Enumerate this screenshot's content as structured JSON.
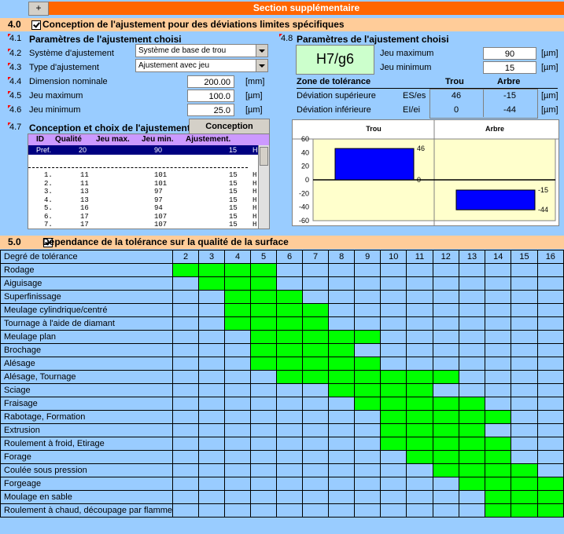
{
  "topbar": {
    "plus": "+",
    "title": "Section supplémentaire"
  },
  "s40": {
    "num": "4.0",
    "title": "Conception de l'ajustement pour des déviations limites spécifiques"
  },
  "s41": {
    "num": "4.1",
    "title": "Paramètres de l'ajustement choisi"
  },
  "r42": {
    "num": "4.2",
    "label": "Système d'ajustement",
    "value": "Système de base de trou"
  },
  "r43": {
    "num": "4.3",
    "label": "Type d'ajustement",
    "value": "Ajustement avec jeu"
  },
  "r44": {
    "num": "4.4",
    "label": "Dimension nominale",
    "value": "200.00",
    "unit": "[mm]"
  },
  "r45": {
    "num": "4.5",
    "label": "Jeu maximum",
    "value": "100.0",
    "unit": "[µm]"
  },
  "r46": {
    "num": "4.6",
    "label": "Jeu minimum",
    "value": "25.0",
    "unit": "[µm]"
  },
  "s47": {
    "num": "4.7",
    "title": "Conception et choix de l'ajustement",
    "button": "Conception"
  },
  "list": {
    "headers": [
      "ID",
      "Qualité",
      "Jeu max.",
      "Jeu min.",
      "Ajustement."
    ],
    "pref": {
      "id": "Pref.",
      "q": "20",
      "max": "90",
      "min": "15",
      "adj": "H"
    },
    "rows": [
      {
        "id": "1.",
        "q": "11",
        "max": "101",
        "min": "15",
        "adj": "H"
      },
      {
        "id": "2.",
        "q": "11",
        "max": "101",
        "min": "15",
        "adj": "H"
      },
      {
        "id": "3.",
        "q": "13",
        "max": "97",
        "min": "15",
        "adj": "H"
      },
      {
        "id": "4.",
        "q": "13",
        "max": "97",
        "min": "15",
        "adj": "H"
      },
      {
        "id": "5.",
        "q": "16",
        "max": "94",
        "min": "15",
        "adj": "H"
      },
      {
        "id": "6.",
        "q": "17",
        "max": "107",
        "min": "15",
        "adj": "H"
      },
      {
        "id": "7.",
        "q": "17",
        "max": "107",
        "min": "15",
        "adj": "H"
      }
    ]
  },
  "s48": {
    "num": "4.8",
    "title": "Paramètres de l'ajustement choisi",
    "fit": "H7/g6",
    "jmax_label": "Jeu maximum",
    "jmax": "90",
    "jmin_label": "Jeu minimum",
    "jmin": "15",
    "unit": "[µm]"
  },
  "tol": {
    "title": "Zone de tolérance",
    "col_trou": "Trou",
    "col_arbre": "Arbre",
    "sup_label": "Déviation supérieure",
    "sup_sym": "ES/es",
    "sup_trou": "46",
    "sup_arbre": "-15",
    "inf_label": "Déviation inférieure",
    "inf_sym": "EI/ei",
    "inf_trou": "0",
    "inf_arbre": "-44",
    "unit": "[µm]"
  },
  "chart_data": {
    "type": "bar",
    "categories": [
      "Trou",
      "Arbre"
    ],
    "series": [
      {
        "upper": 46,
        "lower": 0
      },
      {
        "upper": -15,
        "lower": -44
      }
    ],
    "bar_labels": [
      [
        "46",
        "0"
      ],
      [
        "-15",
        "-44"
      ]
    ],
    "ylim": [
      -60,
      60
    ],
    "yticks": [
      60,
      40,
      20,
      0,
      -20,
      -40,
      -60
    ],
    "bar_color": "#0000ff",
    "bg_color": "#ffffcc"
  },
  "s50": {
    "num": "5.0",
    "title": "Dépendance de la tolérance sur la qualité de la surface"
  },
  "surface": {
    "header": "Degré de tolérance",
    "grades": [
      "2",
      "3",
      "4",
      "5",
      "6",
      "7",
      "8",
      "9",
      "10",
      "11",
      "12",
      "13",
      "14",
      "15",
      "16"
    ],
    "rows": [
      {
        "name": "Rodage",
        "from": 2,
        "to": 5
      },
      {
        "name": "Aiguisage",
        "from": 3,
        "to": 5
      },
      {
        "name": "Superfinissage",
        "from": 4,
        "to": 6
      },
      {
        "name": "Meulage cylindrique/centré",
        "from": 4,
        "to": 7
      },
      {
        "name": "Tournage à l'aide de diamant",
        "from": 4,
        "to": 7
      },
      {
        "name": "Meulage plan",
        "from": 5,
        "to": 9
      },
      {
        "name": "Brochage",
        "from": 5,
        "to": 8
      },
      {
        "name": "Alésage",
        "from": 5,
        "to": 9
      },
      {
        "name": "Alésage, Tournage",
        "from": 6,
        "to": 12
      },
      {
        "name": "Sciage",
        "from": 8,
        "to": 11
      },
      {
        "name": "Fraisage",
        "from": 9,
        "to": 13
      },
      {
        "name": "Rabotage, Formation",
        "from": 10,
        "to": 14
      },
      {
        "name": "Extrusion",
        "from": 10,
        "to": 13
      },
      {
        "name": "Roulement à froid, Etirage",
        "from": 10,
        "to": 14
      },
      {
        "name": "Forage",
        "from": 11,
        "to": 14
      },
      {
        "name": "Coulée sous pression",
        "from": 12,
        "to": 15
      },
      {
        "name": "Forgeage",
        "from": 13,
        "to": 16
      },
      {
        "name": "Moulage en sable",
        "from": 14,
        "to": 16
      },
      {
        "name": "Roulement à chaud, découpage par flamme",
        "from": 14,
        "to": 16
      }
    ]
  }
}
